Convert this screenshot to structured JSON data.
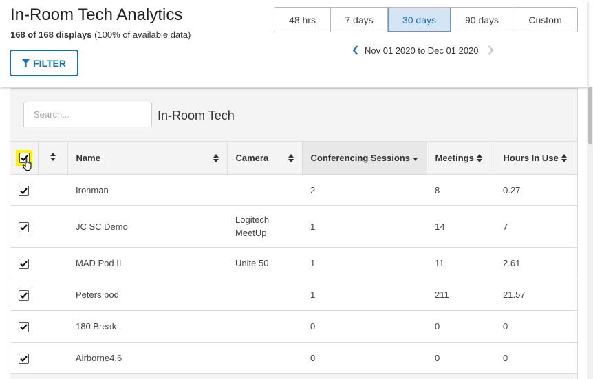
{
  "header": {
    "title": "In-Room Tech Analytics",
    "subtitle_count": "168 of 168 displays",
    "subtitle_rest": " (100% of available data)",
    "filter_label": "FILTER"
  },
  "range": {
    "options": [
      {
        "label": "48 hrs",
        "active": false,
        "width": 82
      },
      {
        "label": "7 days",
        "active": false,
        "width": 83
      },
      {
        "label": "30 days",
        "active": true,
        "width": 92
      },
      {
        "label": "90 days",
        "active": false,
        "width": 90
      },
      {
        "label": "Custom",
        "active": false,
        "width": 93
      }
    ],
    "date_range": "Nov 01 2020 to Dec 01 2020"
  },
  "panel": {
    "search_placeholder": "Search...",
    "title": "In-Room Tech"
  },
  "table": {
    "columns": {
      "name": "Name",
      "camera": "Camera",
      "conferencing": "Conferencing Sessions",
      "meetings": "Meetings",
      "hours": "Hours In Use"
    },
    "rows": [
      {
        "name": "Ironman",
        "camera": "",
        "conferencing": "2",
        "meetings": "8",
        "hours": "0.27"
      },
      {
        "name": "JC SC Demo",
        "camera": "Logitech MeetUp",
        "conferencing": "1",
        "meetings": "14",
        "hours": "7"
      },
      {
        "name": "MAD Pod II",
        "camera": "Unite 50",
        "conferencing": "1",
        "meetings": "11",
        "hours": "2.61"
      },
      {
        "name": "Peters pod",
        "camera": "",
        "conferencing": "1",
        "meetings": "211",
        "hours": "21.57"
      },
      {
        "name": "180 Break",
        "camera": "",
        "conferencing": "0",
        "meetings": "0",
        "hours": "0"
      },
      {
        "name": "Airborne4.6",
        "camera": "",
        "conferencing": "0",
        "meetings": "0",
        "hours": "0"
      }
    ]
  },
  "colors": {
    "accent": "#1a6fb5",
    "highlight": "#fdf000",
    "active_range_bg": "#d4e6f5"
  }
}
